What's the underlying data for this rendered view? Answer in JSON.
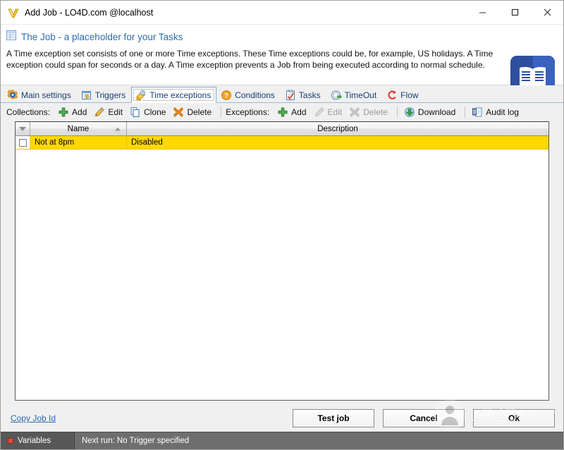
{
  "window": {
    "title": "Add Job - LO4D.com @localhost",
    "app_icon": "v-logo-icon",
    "controls": {
      "minimize": "minimize-icon",
      "maximize": "maximize-icon",
      "close": "close-icon"
    }
  },
  "header": {
    "icon": "grid-table-icon",
    "title": "The Job - a placeholder for your Tasks",
    "description": "A Time exception set consists of one or more Time exceptions. These Time exceptions could be, for example, US holidays. A Time exception could span for seconds or a day. A Time exception prevents a Job from being executed according to normal schedule.",
    "badge_icon": "open-book-icon",
    "accent_color": "#2b6cb0",
    "badge_color": "#2d4f9e"
  },
  "tabs": [
    {
      "label": "Main settings",
      "icon": "gear-icon",
      "active": false
    },
    {
      "label": "Triggers",
      "icon": "trigger-icon",
      "active": false
    },
    {
      "label": "Time exceptions",
      "icon": "time-exception-icon",
      "active": true
    },
    {
      "label": "Conditions",
      "icon": "question-circle-icon",
      "active": false
    },
    {
      "label": "Tasks",
      "icon": "clipboard-check-icon",
      "active": false
    },
    {
      "label": "TimeOut",
      "icon": "timeout-icon",
      "active": false
    },
    {
      "label": "Flow",
      "icon": "flow-icon",
      "active": false
    }
  ],
  "toolbar": {
    "collections_label": "Collections:",
    "collections_actions": [
      {
        "label": "Add",
        "icon": "plus-green-icon",
        "disabled": false
      },
      {
        "label": "Edit",
        "icon": "pencil-icon",
        "disabled": false
      },
      {
        "label": "Clone",
        "icon": "clone-icon",
        "disabled": false
      },
      {
        "label": "Delete",
        "icon": "delete-x-icon",
        "disabled": false
      }
    ],
    "exceptions_label": "Exceptions:",
    "exceptions_actions": [
      {
        "label": "Add",
        "icon": "plus-green-icon",
        "disabled": false
      },
      {
        "label": "Edit",
        "icon": "pencil-icon",
        "disabled": true
      },
      {
        "label": "Delete",
        "icon": "delete-x-icon",
        "disabled": true
      }
    ],
    "extra_actions": [
      {
        "label": "Download",
        "icon": "download-icon",
        "disabled": false
      },
      {
        "label": "Audit log",
        "icon": "audit-log-icon",
        "disabled": false
      }
    ]
  },
  "grid": {
    "columns": [
      {
        "label": "",
        "icon": "filter-icon"
      },
      {
        "label": "Name",
        "sort": "ascending"
      },
      {
        "label": "Description"
      }
    ],
    "rows": [
      {
        "checked": false,
        "name": "Not at 8pm",
        "description": "Disabled",
        "selected": true
      }
    ],
    "selected_row_color": "#ffd800"
  },
  "footer": {
    "copy_job_id_link": "Copy Job Id",
    "buttons": [
      {
        "label": "Test job"
      },
      {
        "label": "Cancel"
      },
      {
        "label": "Ok"
      }
    ]
  },
  "statusbar": {
    "variables_label": "Variables",
    "variables_icon": "red-square-icon",
    "next_run_text": "Next run: No Trigger specified"
  },
  "watermark": {
    "text": "LO4D.com"
  }
}
